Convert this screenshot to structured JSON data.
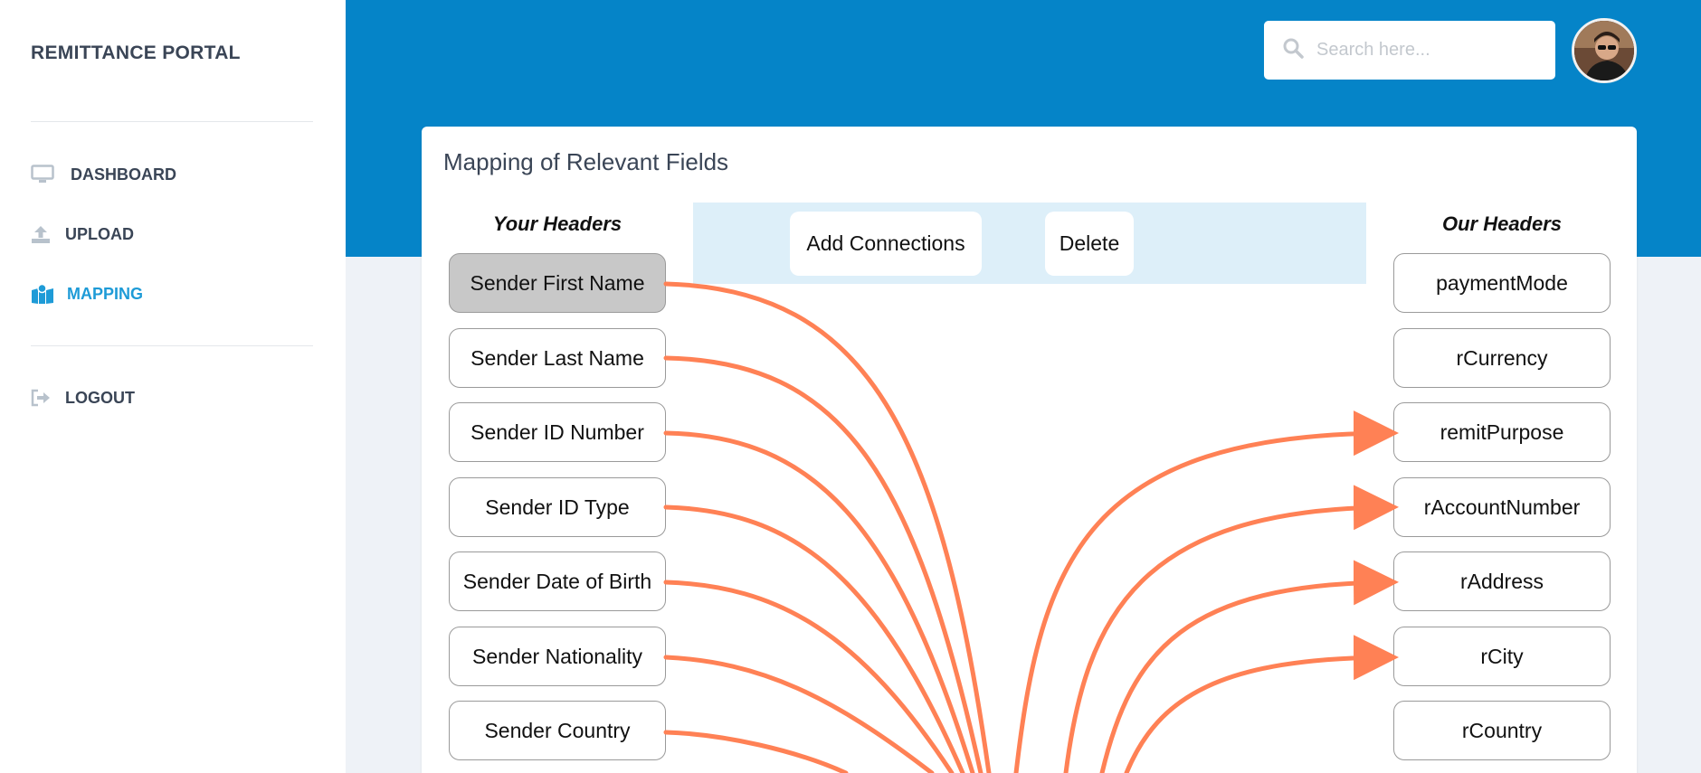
{
  "app": {
    "brand": "REMITTANCE PORTAL"
  },
  "sidebar": {
    "items": [
      {
        "label": "DASHBOARD",
        "icon": "monitor-icon",
        "active": false
      },
      {
        "label": "UPLOAD",
        "icon": "upload-icon",
        "active": false
      },
      {
        "label": "MAPPING",
        "icon": "map-icon",
        "active": true
      },
      {
        "label": "LOGOUT",
        "icon": "logout-icon",
        "active": false
      }
    ]
  },
  "header": {
    "search_placeholder": "Search here..."
  },
  "main": {
    "title": "Mapping of Relevant Fields",
    "your_headers_title": "Your Headers",
    "our_headers_title": "Our Headers",
    "toolbar": {
      "add_label": "Add Connections",
      "delete_label": "Delete"
    },
    "your_headers": [
      "Sender First Name",
      "Sender Last Name",
      "Sender ID Number",
      "Sender ID Type",
      "Sender Date of Birth",
      "Sender Nationality",
      "Sender Country"
    ],
    "our_headers": [
      "paymentMode",
      "rCurrency",
      "remitPurpose",
      "rAccountNumber",
      "rAddress",
      "rCity",
      "rCountry"
    ],
    "selected_your_header": "Sender First Name",
    "connected_our_headers": [
      "remitPurpose",
      "rAccountNumber",
      "rAddress",
      "rCity"
    ]
  },
  "colors": {
    "primary": "#0584c8",
    "accent": "#1e9bd7",
    "connector": "#ff8155",
    "toolbar_bg": "#ddeff9"
  }
}
